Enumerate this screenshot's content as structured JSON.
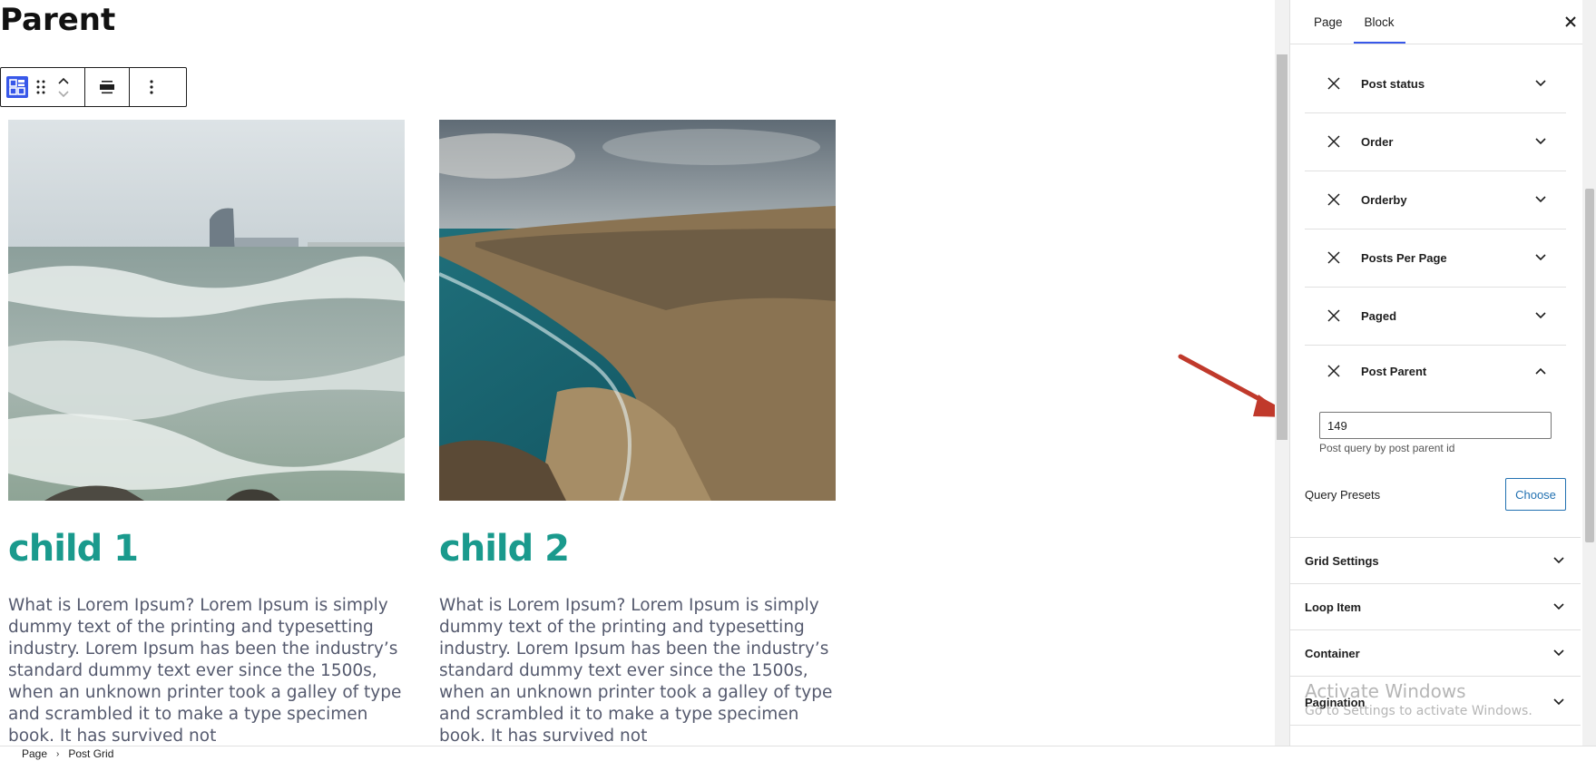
{
  "page": {
    "title": "Parent"
  },
  "toolbar": {
    "block_type_icon": "grid-block-icon",
    "drag_icon": "drag-handle-icon",
    "move_up_icon": "chevron-up-icon",
    "move_down_icon": "chevron-down-icon",
    "align_icon": "align-wide-icon",
    "more_icon": "more-vertical-icon"
  },
  "posts": [
    {
      "title": "child 1",
      "excerpt": "What is Lorem Ipsum? Lorem Ipsum is simply dummy text of the printing and typesetting industry. Lorem Ipsum has been the industry’s standard dummy text ever since the 1500s, when an unknown printer took a galley of type and scrambled it to make a type specimen book. It has survived not",
      "image": "stormy-sea-waves-with-city-skyline"
    },
    {
      "title": "child 2",
      "excerpt": "What is Lorem Ipsum? Lorem Ipsum is simply dummy text of the printing and typesetting industry. Lorem Ipsum has been the industry’s standard dummy text ever since the 1500s, when an unknown printer took a galley of type and scrambled it to make a type specimen book. It has survived not",
      "image": "rocky-coastline-turquoise-water"
    }
  ],
  "sidebar": {
    "tabs": [
      "Page",
      "Block"
    ],
    "active_tab": "Block",
    "close_icon": "close-icon",
    "query_params": [
      {
        "label": "Post status",
        "expanded": false
      },
      {
        "label": "Order",
        "expanded": false
      },
      {
        "label": "Orderby",
        "expanded": false
      },
      {
        "label": "Posts Per Page",
        "expanded": false
      },
      {
        "label": "Paged",
        "expanded": false
      },
      {
        "label": "Post Parent",
        "expanded": true
      }
    ],
    "post_parent": {
      "value": "149",
      "help": "Post query by post parent id"
    },
    "query_presets": {
      "label": "Query Presets",
      "button": "Choose"
    },
    "panels": [
      "Grid Settings",
      "Loop Item",
      "Container",
      "Pagination"
    ]
  },
  "annotation": {
    "color": "#c0392b",
    "icon": "red-arrow-annotation"
  },
  "watermark": {
    "line1": "Activate Windows",
    "line2": "Go to Settings to activate Windows."
  },
  "breadcrumb": [
    "Page",
    "Post Grid"
  ],
  "colors": {
    "accent": "#3858e9",
    "post_title": "#1a9a8d",
    "button": "#2271b1"
  }
}
